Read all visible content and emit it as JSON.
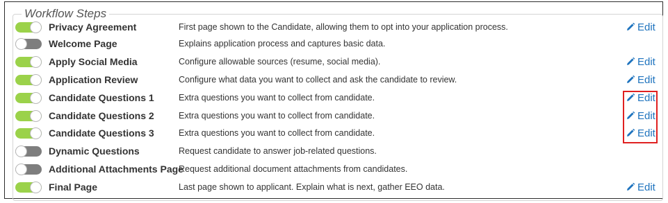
{
  "section_title": "Workflow Steps",
  "edit_label": "Edit",
  "steps": [
    {
      "name": "Privacy Agreement",
      "description": "First page shown to the Candidate, allowing them to opt into your application process.",
      "enabled": true,
      "editable": true
    },
    {
      "name": "Welcome Page",
      "description": "Explains application process and captures basic data.",
      "enabled": false,
      "editable": false
    },
    {
      "name": "Apply Social Media",
      "description": "Configure allowable sources (resume, social media).",
      "enabled": true,
      "editable": true
    },
    {
      "name": "Application Review",
      "description": "Configure what data you want to collect and ask the candidate to review.",
      "enabled": true,
      "editable": true
    },
    {
      "name": "Candidate Questions 1",
      "description": "Extra questions you want to collect from candidate.",
      "enabled": true,
      "editable": true
    },
    {
      "name": "Candidate Questions 2",
      "description": "Extra questions you want to collect from candidate.",
      "enabled": true,
      "editable": true
    },
    {
      "name": "Candidate Questions 3",
      "description": "Extra questions you want to collect from candidate.",
      "enabled": true,
      "editable": true
    },
    {
      "name": "Dynamic Questions",
      "description": "Request candidate to answer job-related questions.",
      "enabled": false,
      "editable": false
    },
    {
      "name": "Additional Attachments Page",
      "description": "Request additional document attachments from candidates.",
      "enabled": false,
      "editable": false
    },
    {
      "name": "Final Page",
      "description": "Last page shown to applicant. Explain what is next, gather EEO data.",
      "enabled": true,
      "editable": true
    }
  ],
  "colors": {
    "toggle_on": "#9bd24a",
    "toggle_off": "#7e7e7e",
    "link": "#1e73be",
    "highlight": "#e02020"
  },
  "icons": {
    "edit": "pencil-icon"
  }
}
